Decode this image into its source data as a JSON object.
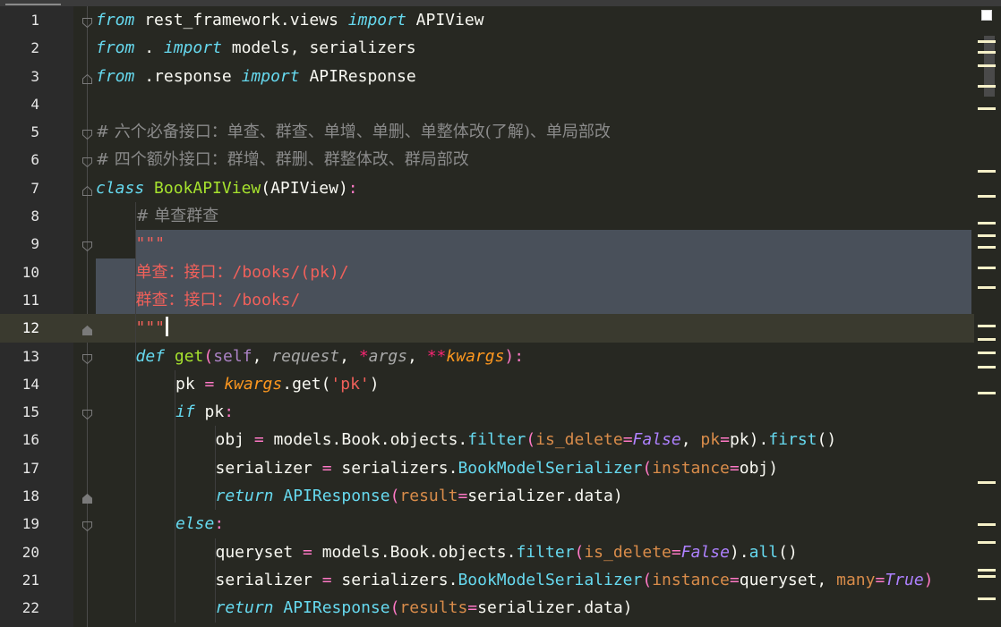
{
  "editor": {
    "lines": [
      {
        "n": "1",
        "fold": "open",
        "tokens": [
          {
            "t": "from",
            "c": "kw"
          },
          {
            "t": " rest_framework.views ",
            "c": "punc"
          },
          {
            "t": "import",
            "c": "kw"
          },
          {
            "t": " APIView",
            "c": "punc"
          }
        ]
      },
      {
        "n": "2",
        "fold": "",
        "tokens": [
          {
            "t": "from",
            "c": "kw"
          },
          {
            "t": " . ",
            "c": "punc"
          },
          {
            "t": "import",
            "c": "kw"
          },
          {
            "t": " models, serializers",
            "c": "punc"
          }
        ]
      },
      {
        "n": "3",
        "fold": "end",
        "tokens": [
          {
            "t": "from",
            "c": "kw"
          },
          {
            "t": " .response ",
            "c": "punc"
          },
          {
            "t": "import",
            "c": "kw"
          },
          {
            "t": " APIResponse",
            "c": "punc"
          }
        ]
      },
      {
        "n": "4",
        "fold": "",
        "tokens": []
      },
      {
        "n": "5",
        "fold": "open",
        "tokens": [
          {
            "t": "# 六个必备接口：单查、群查、单增、单删、单整体改(了解)、单局部改",
            "c": "cm"
          }
        ]
      },
      {
        "n": "6",
        "fold": "open",
        "tokens": [
          {
            "t": "# 四个额外接口：群增、群删、群整体改、群局部改",
            "c": "cm"
          }
        ]
      },
      {
        "n": "7",
        "fold": "end",
        "tokens": [
          {
            "t": "class",
            "c": "kw"
          },
          {
            "t": " ",
            "c": "punc"
          },
          {
            "t": "BookAPIView",
            "c": "cls"
          },
          {
            "t": "(APIView)",
            "c": "punc"
          },
          {
            "t": ":",
            "c": "op"
          }
        ]
      },
      {
        "n": "8",
        "fold": "",
        "indent": 1,
        "tokens": [
          {
            "t": "# 单查群查",
            "c": "cm"
          }
        ]
      },
      {
        "n": "9",
        "fold": "open",
        "indent": 1,
        "sel": "partial",
        "tokens": [
          {
            "t": "\"\"\"",
            "c": "str"
          }
        ]
      },
      {
        "n": "10",
        "fold": "",
        "indent": 1,
        "sel": "full",
        "tokens": [
          {
            "t": "单查：接口：/books/(pk)/",
            "c": "str"
          }
        ]
      },
      {
        "n": "11",
        "fold": "",
        "indent": 1,
        "sel": "full",
        "tokens": [
          {
            "t": "群查：接口：/books/",
            "c": "str"
          }
        ]
      },
      {
        "n": "12",
        "fold": "close",
        "indent": 1,
        "current": true,
        "caret": true,
        "tokens": [
          {
            "t": "\"\"\"",
            "c": "str"
          }
        ]
      },
      {
        "n": "13",
        "fold": "open",
        "indent": 1,
        "tokens": [
          {
            "t": "def",
            "c": "kw"
          },
          {
            "t": " ",
            "c": "punc"
          },
          {
            "t": "get",
            "c": "fn"
          },
          {
            "t": "(",
            "c": "op"
          },
          {
            "t": "self",
            "c": "self"
          },
          {
            "t": ", ",
            "c": "punc"
          },
          {
            "t": "request",
            "c": "param"
          },
          {
            "t": ", ",
            "c": "punc"
          },
          {
            "t": "*",
            "c": "star"
          },
          {
            "t": "args",
            "c": "param"
          },
          {
            "t": ", ",
            "c": "punc"
          },
          {
            "t": "**",
            "c": "star"
          },
          {
            "t": "kwargs",
            "c": "kwarg"
          },
          {
            "t": ")",
            "c": "op"
          },
          {
            "t": ":",
            "c": "op"
          }
        ]
      },
      {
        "n": "14",
        "fold": "",
        "indent": 2,
        "tokens": [
          {
            "t": "pk",
            "c": "punc"
          },
          {
            "t": " = ",
            "c": "op"
          },
          {
            "t": "kwargs",
            "c": "kwvar"
          },
          {
            "t": ".get(",
            "c": "punc"
          },
          {
            "t": "'pk'",
            "c": "str"
          },
          {
            "t": ")",
            "c": "punc"
          }
        ]
      },
      {
        "n": "15",
        "fold": "open",
        "indent": 2,
        "tokens": [
          {
            "t": "if",
            "c": "kw"
          },
          {
            "t": " pk",
            "c": "punc"
          },
          {
            "t": ":",
            "c": "op"
          }
        ]
      },
      {
        "n": "16",
        "fold": "",
        "indent": 3,
        "tokens": [
          {
            "t": "obj",
            "c": "punc"
          },
          {
            "t": " = ",
            "c": "op"
          },
          {
            "t": "models.Book.objects.",
            "c": "punc"
          },
          {
            "t": "filter",
            "c": "attr"
          },
          {
            "t": "(",
            "c": "op"
          },
          {
            "t": "is_delete",
            "c": "named"
          },
          {
            "t": "=",
            "c": "op"
          },
          {
            "t": "False",
            "c": "const"
          },
          {
            "t": ", ",
            "c": "punc"
          },
          {
            "t": "pk",
            "c": "named"
          },
          {
            "t": "=",
            "c": "op"
          },
          {
            "t": "pk).",
            "c": "punc"
          },
          {
            "t": "first",
            "c": "attr"
          },
          {
            "t": "()",
            "c": "punc"
          }
        ]
      },
      {
        "n": "17",
        "fold": "",
        "indent": 3,
        "tokens": [
          {
            "t": "serializer",
            "c": "punc"
          },
          {
            "t": " = ",
            "c": "op"
          },
          {
            "t": "serializers.",
            "c": "punc"
          },
          {
            "t": "BookModelSerializer",
            "c": "attr"
          },
          {
            "t": "(",
            "c": "op"
          },
          {
            "t": "instance",
            "c": "named"
          },
          {
            "t": "=",
            "c": "op"
          },
          {
            "t": "obj)",
            "c": "punc"
          }
        ]
      },
      {
        "n": "18",
        "fold": "close",
        "indent": 3,
        "tokens": [
          {
            "t": "return",
            "c": "kw"
          },
          {
            "t": " APIResponse",
            "c": "attr"
          },
          {
            "t": "(",
            "c": "op"
          },
          {
            "t": "result",
            "c": "named"
          },
          {
            "t": "=",
            "c": "op"
          },
          {
            "t": "serializer.data)",
            "c": "punc"
          }
        ]
      },
      {
        "n": "19",
        "fold": "open",
        "indent": 2,
        "tokens": [
          {
            "t": "else",
            "c": "kw"
          },
          {
            "t": ":",
            "c": "op"
          }
        ]
      },
      {
        "n": "20",
        "fold": "",
        "indent": 3,
        "tokens": [
          {
            "t": "queryset",
            "c": "punc"
          },
          {
            "t": " = ",
            "c": "op"
          },
          {
            "t": "models.Book.objects.",
            "c": "punc"
          },
          {
            "t": "filter",
            "c": "attr"
          },
          {
            "t": "(",
            "c": "op"
          },
          {
            "t": "is_delete",
            "c": "named"
          },
          {
            "t": "=",
            "c": "op"
          },
          {
            "t": "False",
            "c": "const"
          },
          {
            "t": ").",
            "c": "punc"
          },
          {
            "t": "all",
            "c": "attr"
          },
          {
            "t": "()",
            "c": "punc"
          }
        ]
      },
      {
        "n": "21",
        "fold": "",
        "indent": 3,
        "tokens": [
          {
            "t": "serializer",
            "c": "punc"
          },
          {
            "t": " = ",
            "c": "op"
          },
          {
            "t": "serializers.",
            "c": "punc"
          },
          {
            "t": "BookModelSerializer",
            "c": "attr"
          },
          {
            "t": "(",
            "c": "op"
          },
          {
            "t": "instance",
            "c": "named"
          },
          {
            "t": "=",
            "c": "op"
          },
          {
            "t": "queryset, ",
            "c": "punc"
          },
          {
            "t": "many",
            "c": "named"
          },
          {
            "t": "=",
            "c": "op"
          },
          {
            "t": "True",
            "c": "const"
          },
          {
            "t": ")",
            "c": "op"
          }
        ]
      },
      {
        "n": "22",
        "fold": "",
        "indent": 3,
        "tokens": [
          {
            "t": "return",
            "c": "kw"
          },
          {
            "t": " APIResponse",
            "c": "attr"
          },
          {
            "t": "(",
            "c": "op"
          },
          {
            "t": "results",
            "c": "named"
          },
          {
            "t": "=",
            "c": "op"
          },
          {
            "t": "serializer.data)",
            "c": "punc"
          }
        ]
      }
    ]
  },
  "colors": {
    "background": "#272822",
    "gutter": "#2b2b2b",
    "selection": "#49505a",
    "current_line": "#3a3a2f",
    "keyword": "#66d9ef",
    "function": "#a6e22e",
    "string": "#f0605a",
    "comment": "#8a8a8a"
  },
  "icons": {
    "fold_open": "fold-open-icon",
    "fold_close": "fold-close-icon"
  }
}
